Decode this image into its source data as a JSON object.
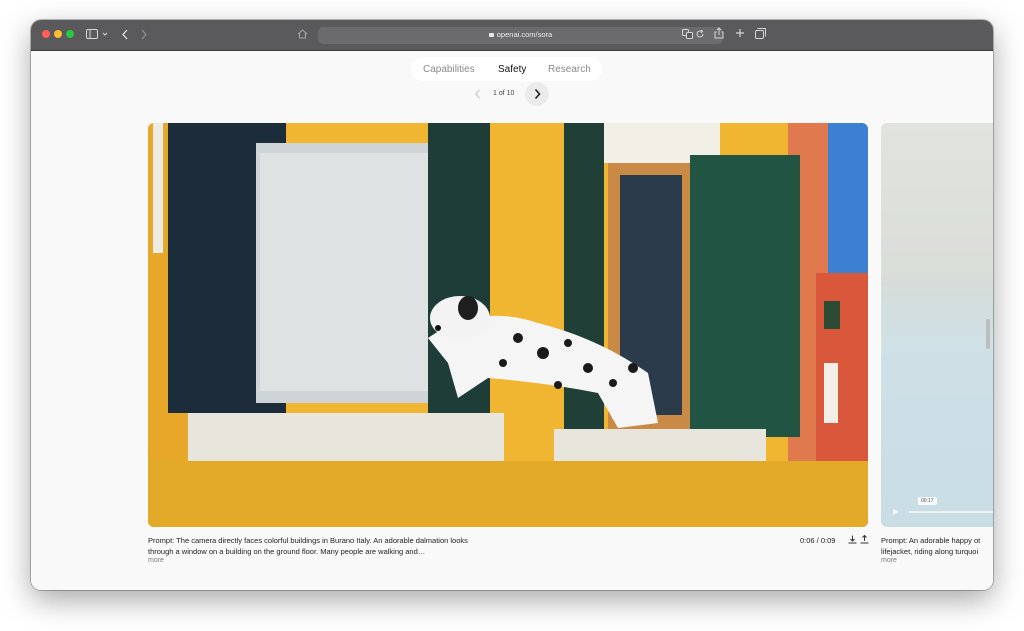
{
  "browser": {
    "url": "openai.com/sora",
    "colors": {
      "toolbar": "#5a5a5c",
      "close": "#ff5f57",
      "minimize": "#febc2e",
      "zoom": "#28c840"
    }
  },
  "nav": {
    "tabs": [
      {
        "label": "Capabilities",
        "selected": false
      },
      {
        "label": "Safety",
        "selected": true
      },
      {
        "label": "Research",
        "selected": false
      }
    ]
  },
  "pager": {
    "count": "1 of 10"
  },
  "video": {
    "prompt": "Prompt: The camera directly faces colorful buildings in Burano Italy. An adorable dalmation looks through a window on a building on the ground floor. Many people are walking and…",
    "more_label": "more",
    "time": "0:06 / 0:09"
  },
  "next_video": {
    "prompt_line1": "Prompt: An adorable happy ot",
    "prompt_line2": "lifejacket, riding along turquoi",
    "more_label": "more",
    "time_badge": "00:17"
  },
  "icons": {
    "sidebar": "sidebar-icon",
    "back": "chevron-left-icon",
    "forward": "chevron-right-icon",
    "home": "home-icon",
    "translate": "translate-icon",
    "reload": "reload-icon",
    "share": "share-icon",
    "new_tab": "plus-icon",
    "tabs": "tab-overview-icon",
    "download": "download-icon",
    "upload": "share-icon"
  }
}
